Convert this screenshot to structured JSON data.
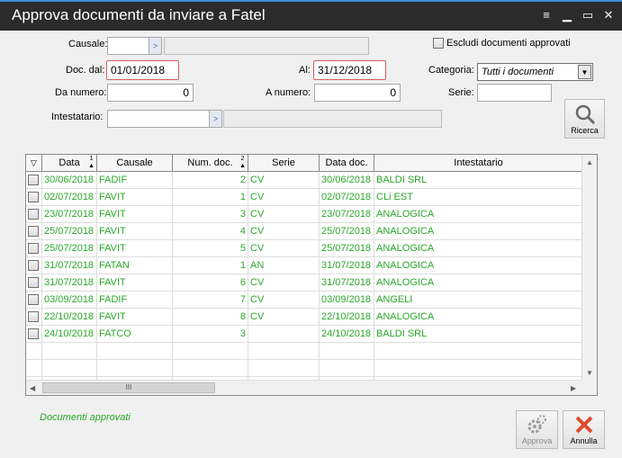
{
  "window": {
    "title": "Approva documenti da inviare a Fatel"
  },
  "filters": {
    "causale_label": "Causale:",
    "causale_value": "",
    "causale_desc": "",
    "escludi_label": "Escludi documenti approvati",
    "doc_dal_label": "Doc. dal:",
    "doc_dal_value": "01/01/2018",
    "al_label": "Al:",
    "al_value": "31/12/2018",
    "categoria_label": "Categoria:",
    "categoria_value": "Tutti i documenti",
    "da_numero_label": "Da numero:",
    "da_numero_value": "0",
    "a_numero_label": "A numero:",
    "a_numero_value": "0",
    "serie_label": "Serie:",
    "serie_value": "",
    "intestatario_label": "Intestatario:",
    "intestatario_value": "",
    "intestatario_desc": "",
    "ricerca_label": "Ricerca"
  },
  "grid": {
    "columns": [
      {
        "label": "Data",
        "sort": "1"
      },
      {
        "label": "Causale",
        "sort": ""
      },
      {
        "label": "Num. doc.",
        "sort": "2"
      },
      {
        "label": "Serie",
        "sort": ""
      },
      {
        "label": "Data doc.",
        "sort": ""
      },
      {
        "label": "Intestatario",
        "sort": ""
      }
    ],
    "rows": [
      {
        "data": "30/06/2018",
        "causale": "FADIF",
        "num": "2",
        "serie": "CV",
        "data_doc": "30/06/2018",
        "intestatario": "BALDI SRL"
      },
      {
        "data": "02/07/2018",
        "causale": "FAVIT",
        "num": "1",
        "serie": "CV",
        "data_doc": "02/07/2018",
        "intestatario": "CLi EST"
      },
      {
        "data": "23/07/2018",
        "causale": "FAVIT",
        "num": "3",
        "serie": "CV",
        "data_doc": "23/07/2018",
        "intestatario": "ANALOGICA"
      },
      {
        "data": "25/07/2018",
        "causale": "FAVIT",
        "num": "4",
        "serie": "CV",
        "data_doc": "25/07/2018",
        "intestatario": "ANALOGICA"
      },
      {
        "data": "25/07/2018",
        "causale": "FAVIT",
        "num": "5",
        "serie": "CV",
        "data_doc": "25/07/2018",
        "intestatario": "ANALOGICA"
      },
      {
        "data": "31/07/2018",
        "causale": "FATAN",
        "num": "1",
        "serie": "AN",
        "data_doc": "31/07/2018",
        "intestatario": "ANALOGICA"
      },
      {
        "data": "31/07/2018",
        "causale": "FAVIT",
        "num": "6",
        "serie": "CV",
        "data_doc": "31/07/2018",
        "intestatario": "ANALOGICA"
      },
      {
        "data": "03/09/2018",
        "causale": "FADIF",
        "num": "7",
        "serie": "CV",
        "data_doc": "03/09/2018",
        "intestatario": "ANGELI"
      },
      {
        "data": "22/10/2018",
        "causale": "FAVIT",
        "num": "8",
        "serie": "CV",
        "data_doc": "22/10/2018",
        "intestatario": "ANALOGICA"
      },
      {
        "data": "24/10/2018",
        "causale": "FATCO",
        "num": "3",
        "serie": "",
        "data_doc": "24/10/2018",
        "intestatario": "BALDI SRL"
      }
    ],
    "hscroll_thumb": "III"
  },
  "status": {
    "legend": "Documenti approvati"
  },
  "buttons": {
    "approva": "Approva",
    "annulla": "Annulla"
  },
  "colors": {
    "titlebar": "#2b2b2b",
    "approved_text": "#2aa82a",
    "required_border": "#d06060",
    "cancel_icon": "#e04a2a"
  }
}
